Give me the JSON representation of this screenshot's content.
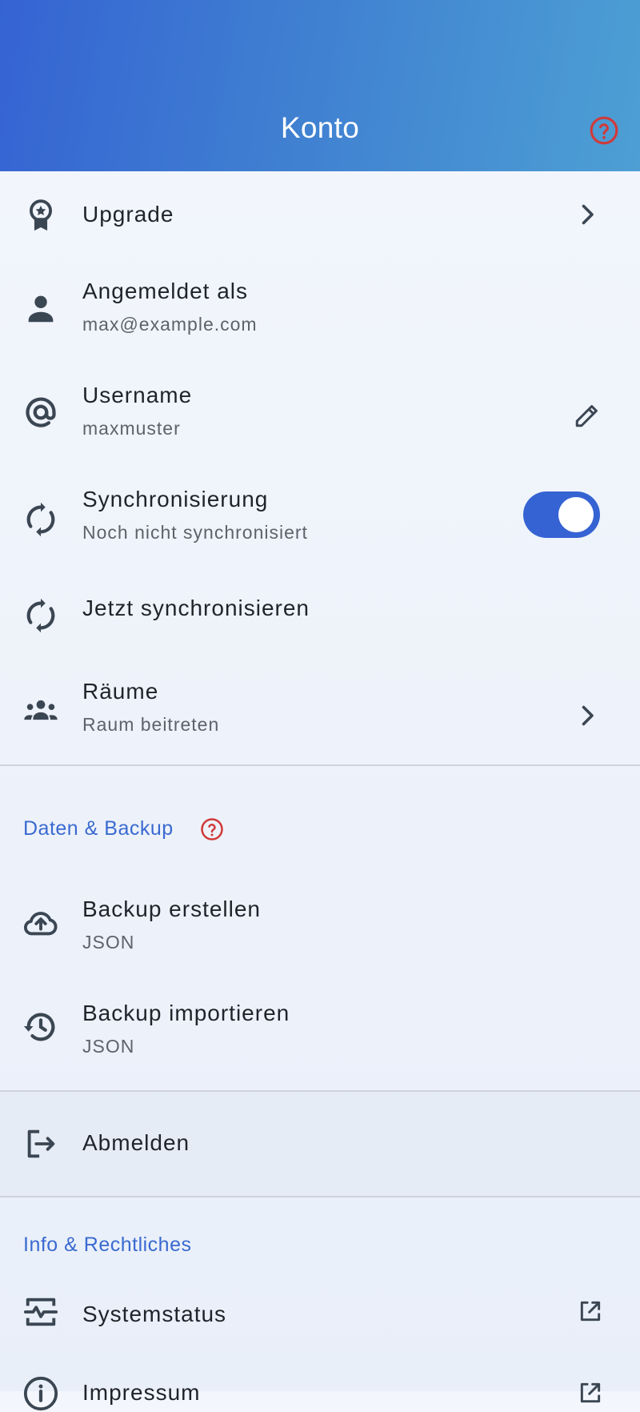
{
  "header": {
    "title": "Konto",
    "help_icon": "help-circle-icon"
  },
  "colors": {
    "accent": "#3563d3",
    "help_red": "#d03a3a",
    "section_label": "#3a6ad0"
  },
  "items": {
    "upgrade": {
      "title": "Upgrade"
    },
    "signed_in": {
      "title": "Angemeldet als",
      "subtitle": "max@example.com"
    },
    "username": {
      "title": "Username",
      "subtitle": "maxmuster"
    },
    "sync": {
      "title": "Synchronisierung",
      "subtitle": "Noch nicht synchronisiert",
      "enabled": true
    },
    "sync_now": {
      "title": "Jetzt synchronisieren"
    },
    "rooms": {
      "title": "Räume",
      "subtitle": "Raum beitreten"
    }
  },
  "sections": {
    "backup": {
      "label": "Daten & Backup",
      "create": {
        "title": "Backup erstellen",
        "subtitle": "JSON"
      },
      "import": {
        "title": "Backup importieren",
        "subtitle": "JSON"
      }
    },
    "logout": {
      "title": "Abmelden"
    },
    "info": {
      "label": "Info & Rechtliches",
      "status": {
        "title": "Systemstatus"
      },
      "imprint": {
        "title": "Impressum"
      }
    }
  }
}
